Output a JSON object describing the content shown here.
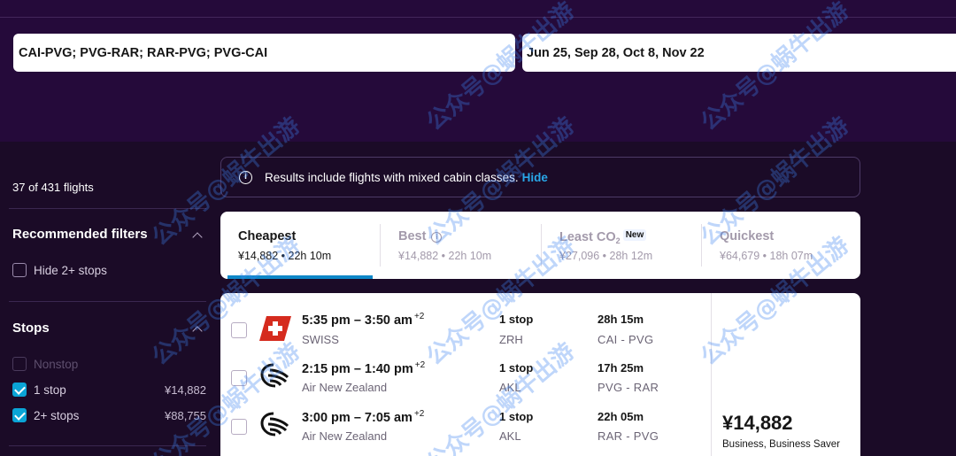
{
  "search": {
    "route": "CAI-PVG; PVG-RAR; RAR-PVG; PVG-CAI",
    "dates": "Jun 25, Sep 28, Oct 8, Nov 22"
  },
  "sidebar": {
    "flight_count": "37 of 431 flights",
    "recommended": {
      "title": "Recommended filters",
      "items": [
        {
          "label": "Hide 2+ stops",
          "checked": false
        }
      ]
    },
    "stops": {
      "title": "Stops",
      "items": [
        {
          "label": "Nonstop",
          "price": "",
          "checked": false,
          "disabled": true
        },
        {
          "label": "1 stop",
          "price": "¥14,882",
          "checked": true,
          "disabled": false
        },
        {
          "label": "2+ stops",
          "price": "¥88,755",
          "checked": true,
          "disabled": false
        }
      ]
    }
  },
  "banner": {
    "text": "Results include flights with mixed cabin classes.",
    "link": "Hide",
    "icon": "info-icon"
  },
  "sort_tabs": [
    {
      "title": "Cheapest",
      "sub": "¥14,882 • 22h 10m",
      "active": true
    },
    {
      "title": "Best",
      "sub": "¥14,882 • 22h 10m",
      "active": false
    },
    {
      "title": "Least CO",
      "title_sub": "2",
      "badge": "New",
      "sub": "¥27,096 • 28h 12m",
      "active": false
    },
    {
      "title": "Quickest",
      "sub": "¥64,679 • 18h 07m",
      "active": false
    }
  ],
  "result": {
    "legs": [
      {
        "time": "5:35 pm – 3:50 am",
        "plus": "+2",
        "airline": "SWISS",
        "logo": "swiss-logo",
        "stops": "1 stop",
        "via": "ZRH",
        "duration": "28h 15m",
        "route": "CAI - PVG"
      },
      {
        "time": "2:15 pm – 1:40 pm",
        "plus": "+2",
        "airline": "Air New Zealand",
        "logo": "air-new-zealand-logo",
        "stops": "1 stop",
        "via": "AKL",
        "duration": "17h 25m",
        "route": "PVG - RAR"
      },
      {
        "time": "3:00 pm – 7:05 am",
        "plus": "+2",
        "airline": "Air New Zealand",
        "logo": "air-new-zealand-logo",
        "stops": "1 stop",
        "via": "AKL",
        "duration": "22h 05m",
        "route": "RAR - PVG"
      }
    ],
    "price": "¥14,882",
    "cabin": "Business, Business Saver"
  },
  "watermark": "公众号@蜗牛出游",
  "colors": {
    "accent": "#0e87c8",
    "link": "#29a7e8",
    "header_bg": "#250a3a",
    "page_bg": "#1b0b27",
    "swiss_red": "#d52b1e"
  }
}
